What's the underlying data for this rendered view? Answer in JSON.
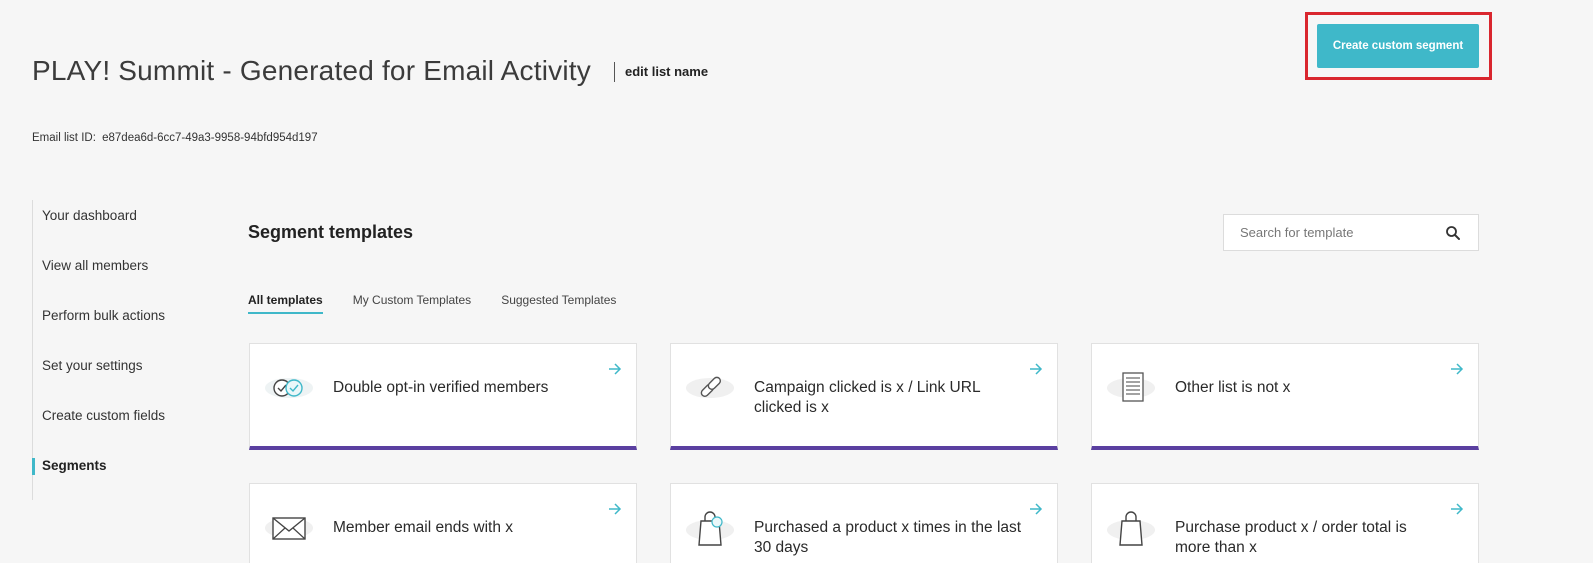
{
  "header": {
    "title": "PLAY! Summit - Generated for Email Activity",
    "edit_link": "edit list name",
    "list_id_label": "Email list ID:",
    "list_id_value": "e87dea6d-6cc7-49a3-9958-94bfd954d197",
    "create_button": "Create custom segment"
  },
  "sidebar": {
    "items": [
      {
        "label": "Your dashboard"
      },
      {
        "label": "View all members"
      },
      {
        "label": "Perform bulk actions"
      },
      {
        "label": "Set your settings"
      },
      {
        "label": "Create custom fields"
      },
      {
        "label": "Segments",
        "active": true
      }
    ]
  },
  "main": {
    "section_title": "Segment templates",
    "search": {
      "placeholder": "Search for template",
      "value": ""
    },
    "tabs": [
      {
        "label": "All templates",
        "active": true
      },
      {
        "label": "My Custom Templates"
      },
      {
        "label": "Suggested Templates"
      }
    ],
    "cards": [
      {
        "label": "Double opt-in verified members",
        "icon": "verified-check-icon"
      },
      {
        "label": "Campaign clicked is x / Link URL clicked is x",
        "icon": "link-icon"
      },
      {
        "label": "Other list is not x",
        "icon": "list-document-icon"
      },
      {
        "label": "Member email ends with x",
        "icon": "envelope-icon"
      },
      {
        "label": "Purchased a product x times in the last 30 days",
        "icon": "shopping-bag-icon"
      },
      {
        "label": "Purchase product x / order total is more than x",
        "icon": "shopping-bag-icon"
      }
    ]
  },
  "colors": {
    "accent": "#3fb8c9",
    "card_border_bottom": "#5a3fa0",
    "highlight": "#d9262e",
    "background": "#f6f6f6"
  }
}
